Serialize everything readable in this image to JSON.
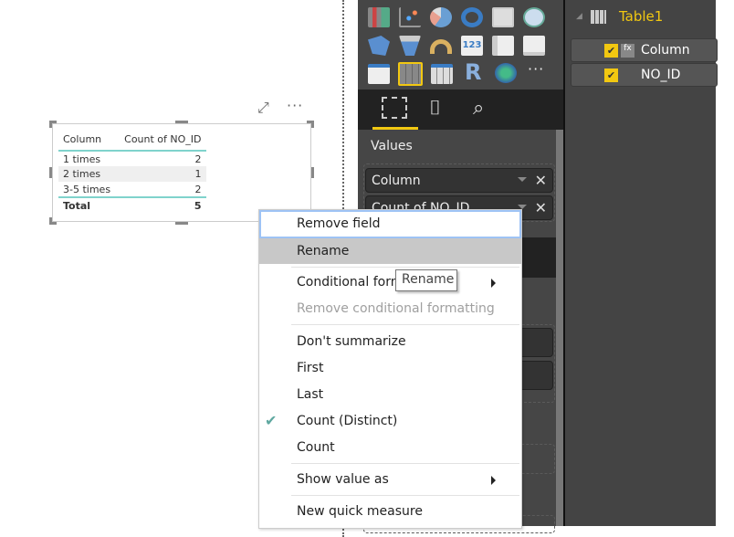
{
  "visual": {
    "headers": [
      "Column",
      "Count of NO_ID"
    ],
    "rows": [
      [
        "1 times",
        "2"
      ],
      [
        "2 times",
        "1"
      ],
      [
        "3-5 times",
        "2"
      ]
    ],
    "total": [
      "Total",
      "5"
    ],
    "focus_icon": "focus-mode-icon",
    "more_icon": "more-options-icon",
    "more_label": "···"
  },
  "visualizations": {
    "tabs": [
      "fields-icon",
      "format-paint-roller-icon",
      "analytics-icon"
    ],
    "values_label": "Values",
    "wells": [
      "Column",
      "Count of NO_ID"
    ],
    "more_label": "···",
    "r_label": "R",
    "card_label": "123"
  },
  "fields": {
    "table": "Table1",
    "items": [
      {
        "label": "Column",
        "checked": true,
        "calc": true
      },
      {
        "label": "NO_ID",
        "checked": true,
        "calc": false
      }
    ]
  },
  "menu": {
    "items": [
      "Remove field",
      "Rename",
      "Conditional formatting",
      "Remove conditional formatting",
      "Don't summarize",
      "First",
      "Last",
      "Count (Distinct)",
      "Count",
      "Show value as",
      "New quick measure"
    ],
    "checked": "Count (Distinct)",
    "check_glyph": "✔",
    "tooltip": "Rename"
  },
  "colors": {
    "accent": "#f2c811",
    "table_rule": "#7fd3cc",
    "check": "#5fa8a0"
  }
}
